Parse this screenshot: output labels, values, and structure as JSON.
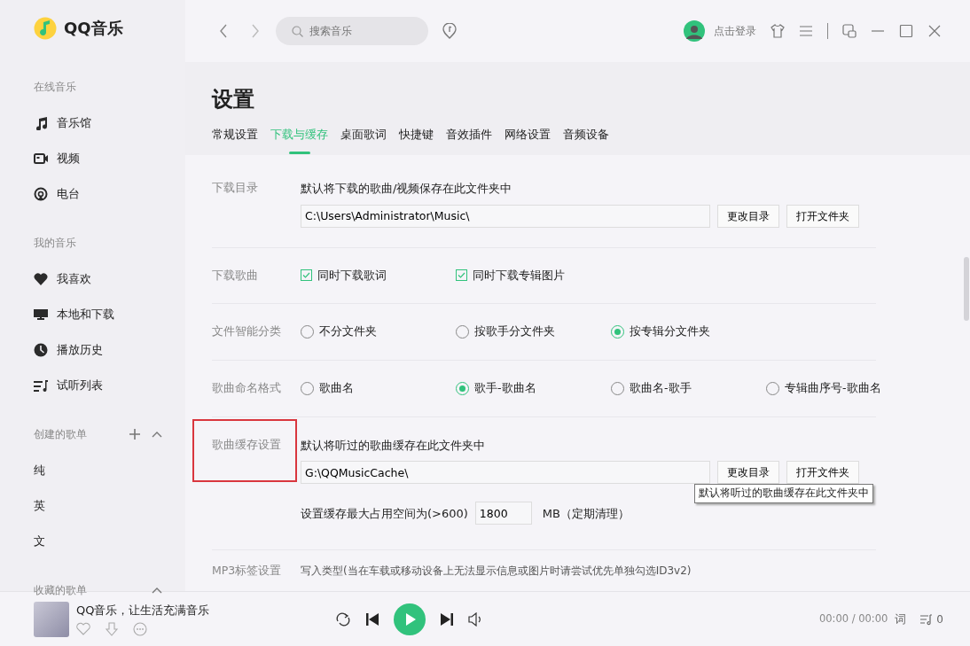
{
  "app": {
    "logo_text": "QQ音乐"
  },
  "sidebar": {
    "sections": [
      {
        "title": "在线音乐",
        "items": [
          {
            "label": "音乐馆",
            "kind": "music"
          },
          {
            "label": "视频",
            "kind": "video"
          },
          {
            "label": "电台",
            "kind": "radio"
          }
        ]
      },
      {
        "title": "我的音乐",
        "items": [
          {
            "label": "我喜欢",
            "kind": "heart"
          },
          {
            "label": "本地和下载",
            "kind": "monitor"
          },
          {
            "label": "播放历史",
            "kind": "clock"
          },
          {
            "label": "试听列表",
            "kind": "list"
          }
        ]
      },
      {
        "title": "创建的歌单",
        "can_add": true,
        "expanded": true,
        "items": [
          {
            "label": "纯",
            "kind": "plain"
          },
          {
            "label": "英",
            "kind": "plain"
          },
          {
            "label": "文",
            "kind": "plain"
          }
        ]
      },
      {
        "title": "收藏的歌单",
        "expanded": true
      }
    ]
  },
  "topbar": {
    "search": {
      "placeholder": "搜索音乐"
    },
    "login": "点击登录"
  },
  "page": {
    "title": "设置",
    "tabs": [
      {
        "label": "常规设置",
        "selected": false
      },
      {
        "label": "下载与缓存",
        "selected": true
      },
      {
        "label": "桌面歌词",
        "selected": false
      },
      {
        "label": "快捷键",
        "selected": false
      },
      {
        "label": "音效插件",
        "selected": false
      },
      {
        "label": "网络设置",
        "selected": false
      },
      {
        "label": "音频设备",
        "selected": false
      }
    ]
  },
  "settings": [
    {
      "kind": "folder",
      "label": "下载目录",
      "highlighted": false,
      "description": "默认将下载的歌曲/视频保存在此文件夹中",
      "path": "C:\\Users\\Administrator\\Music\\",
      "buttons": [
        "更改目录",
        "打开文件夹"
      ]
    },
    {
      "kind": "checks",
      "label": "下载歌曲",
      "options": [
        {
          "label": "同时下载歌词",
          "checked": true
        },
        {
          "label": "同时下载专辑图片",
          "checked": true
        }
      ]
    },
    {
      "kind": "radios",
      "label": "文件智能分类",
      "options": [
        {
          "label": "不分文件夹",
          "selected": false
        },
        {
          "label": "按歌手分文件夹",
          "selected": false
        },
        {
          "label": "按专辑分文件夹",
          "selected": true
        }
      ]
    },
    {
      "kind": "radios",
      "label": "歌曲命名格式",
      "options": [
        {
          "label": "歌曲名",
          "selected": false
        },
        {
          "label": "歌手-歌曲名",
          "selected": true
        },
        {
          "label": "歌曲名-歌手",
          "selected": false
        },
        {
          "label": "专辑曲序号-歌曲名",
          "selected": false
        }
      ]
    },
    {
      "kind": "folder",
      "label": "歌曲缓存设置",
      "highlighted": true,
      "description": "默认将听过的歌曲缓存在此文件夹中",
      "path": "G:\\QQMusicCache\\",
      "buttons": [
        "更改目录",
        "打开文件夹"
      ],
      "tooltip": "默认将听过的歌曲缓存在此文件夹中",
      "limit": {
        "label": "设置缓存最大占用空间为(>600)",
        "value": "1800",
        "unit": "MB（定期清理）"
      }
    },
    {
      "kind": "text",
      "label": "MP3标签设置",
      "description": "写入类型(当在车载或移动设备上无法显示信息或图片时请尝试优先单独勾选ID3v2)"
    }
  ],
  "player": {
    "title": "QQ音乐，让生活充满音乐",
    "time": "00:00 / 00:00",
    "lyrics": "词",
    "queue_count": "0"
  }
}
